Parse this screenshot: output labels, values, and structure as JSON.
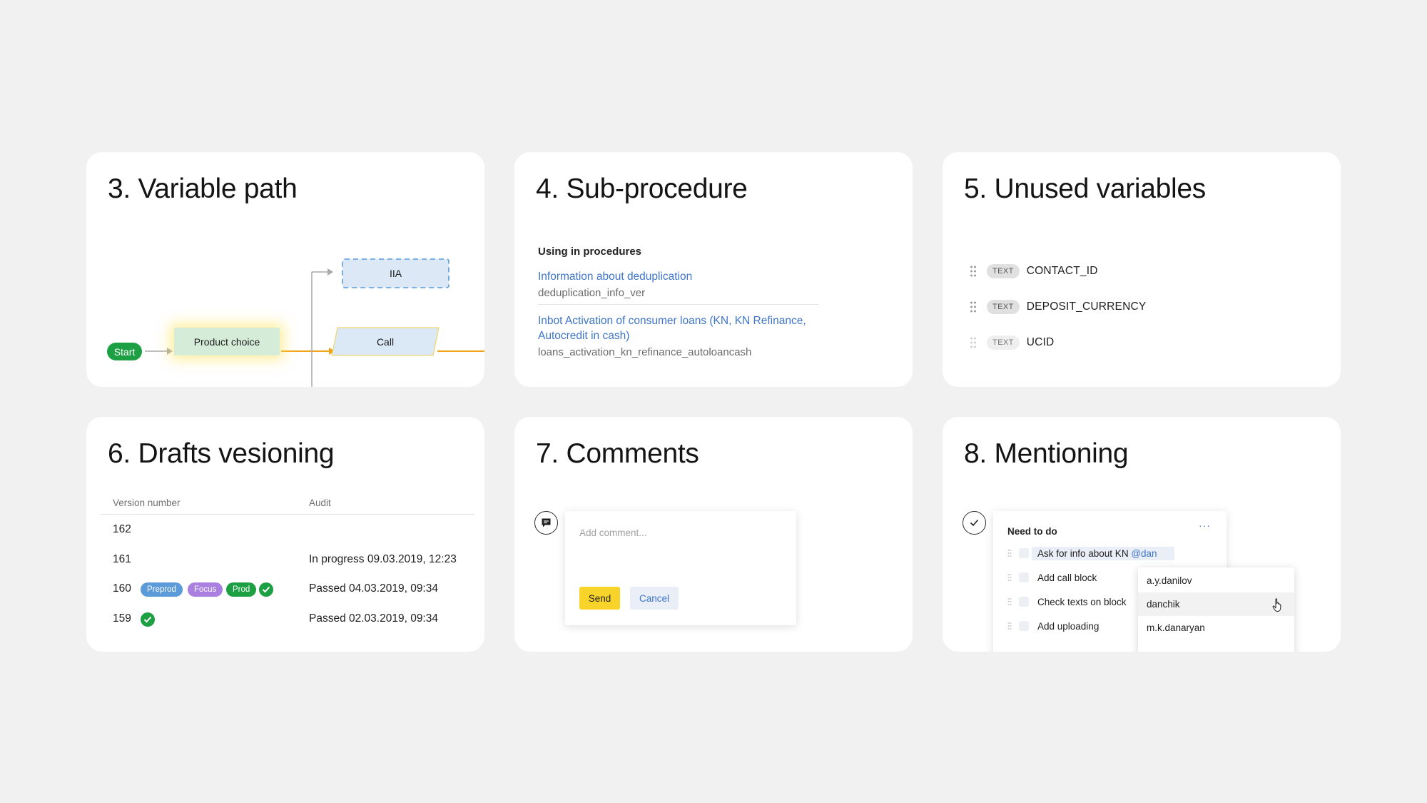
{
  "cards": {
    "variable_path": {
      "title": "3. Variable path",
      "nodes": {
        "start": "Start",
        "product_choice": "Product choice",
        "call": "Call",
        "iia": "IIA"
      }
    },
    "sub_procedure": {
      "title": "4. Sub-procedure",
      "heading": "Using in procedures",
      "procedures": [
        {
          "name": "Information about deduplication",
          "code": "deduplication_info_ver"
        },
        {
          "name_line1": "Inbot Activation of consumer loans (KN, KN Refinance,",
          "name_line2": "Autocredit in cash)",
          "code": "loans_activation_kn_refinance_autoloancash"
        }
      ]
    },
    "unused_variables": {
      "title": "5. Unused variables",
      "variables": [
        {
          "type": "TEXT",
          "name": "CONTACT_ID"
        },
        {
          "type": "TEXT",
          "name": "DEPOSIT_CURRENCY"
        },
        {
          "type": "TEXT",
          "name": "UCID"
        }
      ]
    },
    "drafts_versioning": {
      "title": "6. Drafts vesioning",
      "columns": {
        "version": "Version number",
        "audit": "Audit"
      },
      "rows": [
        {
          "version": "162",
          "audit": ""
        },
        {
          "version": "161",
          "audit": "In progress 09.03.2019, 12:23"
        },
        {
          "version": "160",
          "audit": "Passed 04.03.2019, 09:34",
          "tags": [
            "Preprod",
            "Focus",
            "Prod"
          ]
        },
        {
          "version": "159",
          "audit": "Passed 02.03.2019, 09:34"
        }
      ],
      "tag_colors": {
        "Preprod": "#5b9bd9",
        "Focus": "#a97fe0",
        "Prod": "#1d9f43"
      }
    },
    "comments": {
      "title": "7. Comments",
      "placeholder": "Add comment...",
      "send": "Send",
      "cancel": "Cancel"
    },
    "mentioning": {
      "title": "8. Mentioning",
      "list_title": "Need to do",
      "more": "···",
      "tasks": [
        {
          "text": "Ask for info about KN ",
          "mention": "@dan"
        },
        {
          "text": "Add call block"
        },
        {
          "text": "Check texts on block"
        },
        {
          "text": "Add uploading"
        }
      ],
      "suggestions": [
        "a.y.danilov",
        "danchik",
        "m.k.danaryan"
      ]
    }
  },
  "colors": {
    "accent_blue": "#3e75c9",
    "success_green": "#1d9f43",
    "send_yellow": "#f8d42b",
    "flow_orange": "#f0a41c"
  }
}
